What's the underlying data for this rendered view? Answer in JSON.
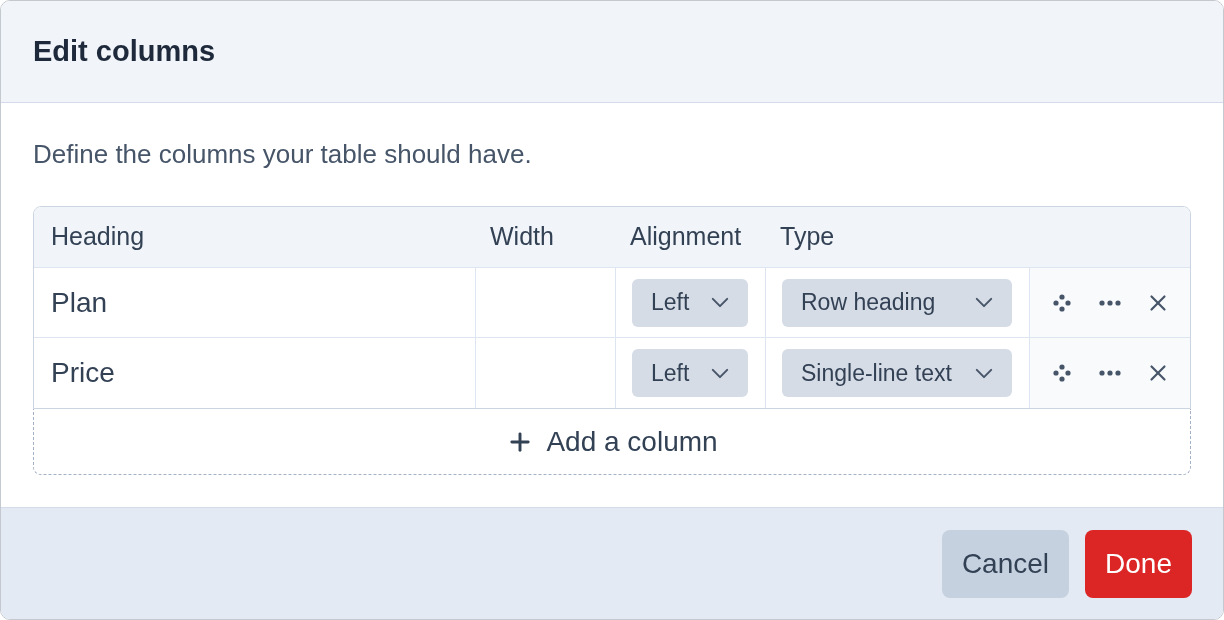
{
  "dialog": {
    "title": "Edit columns",
    "description": "Define the columns your table should have."
  },
  "table": {
    "columns": [
      "Heading",
      "Width",
      "Alignment",
      "Type"
    ],
    "rows": [
      {
        "heading": "Plan",
        "alignment": "Left",
        "type": "Row heading"
      },
      {
        "heading": "Price",
        "alignment": "Left",
        "type": "Single-line text"
      }
    ],
    "add_button": "Add a column"
  },
  "footer": {
    "buttons": [
      {
        "label": "Cancel",
        "kind": "secondary"
      },
      {
        "label": "Done",
        "kind": "primary"
      }
    ]
  }
}
